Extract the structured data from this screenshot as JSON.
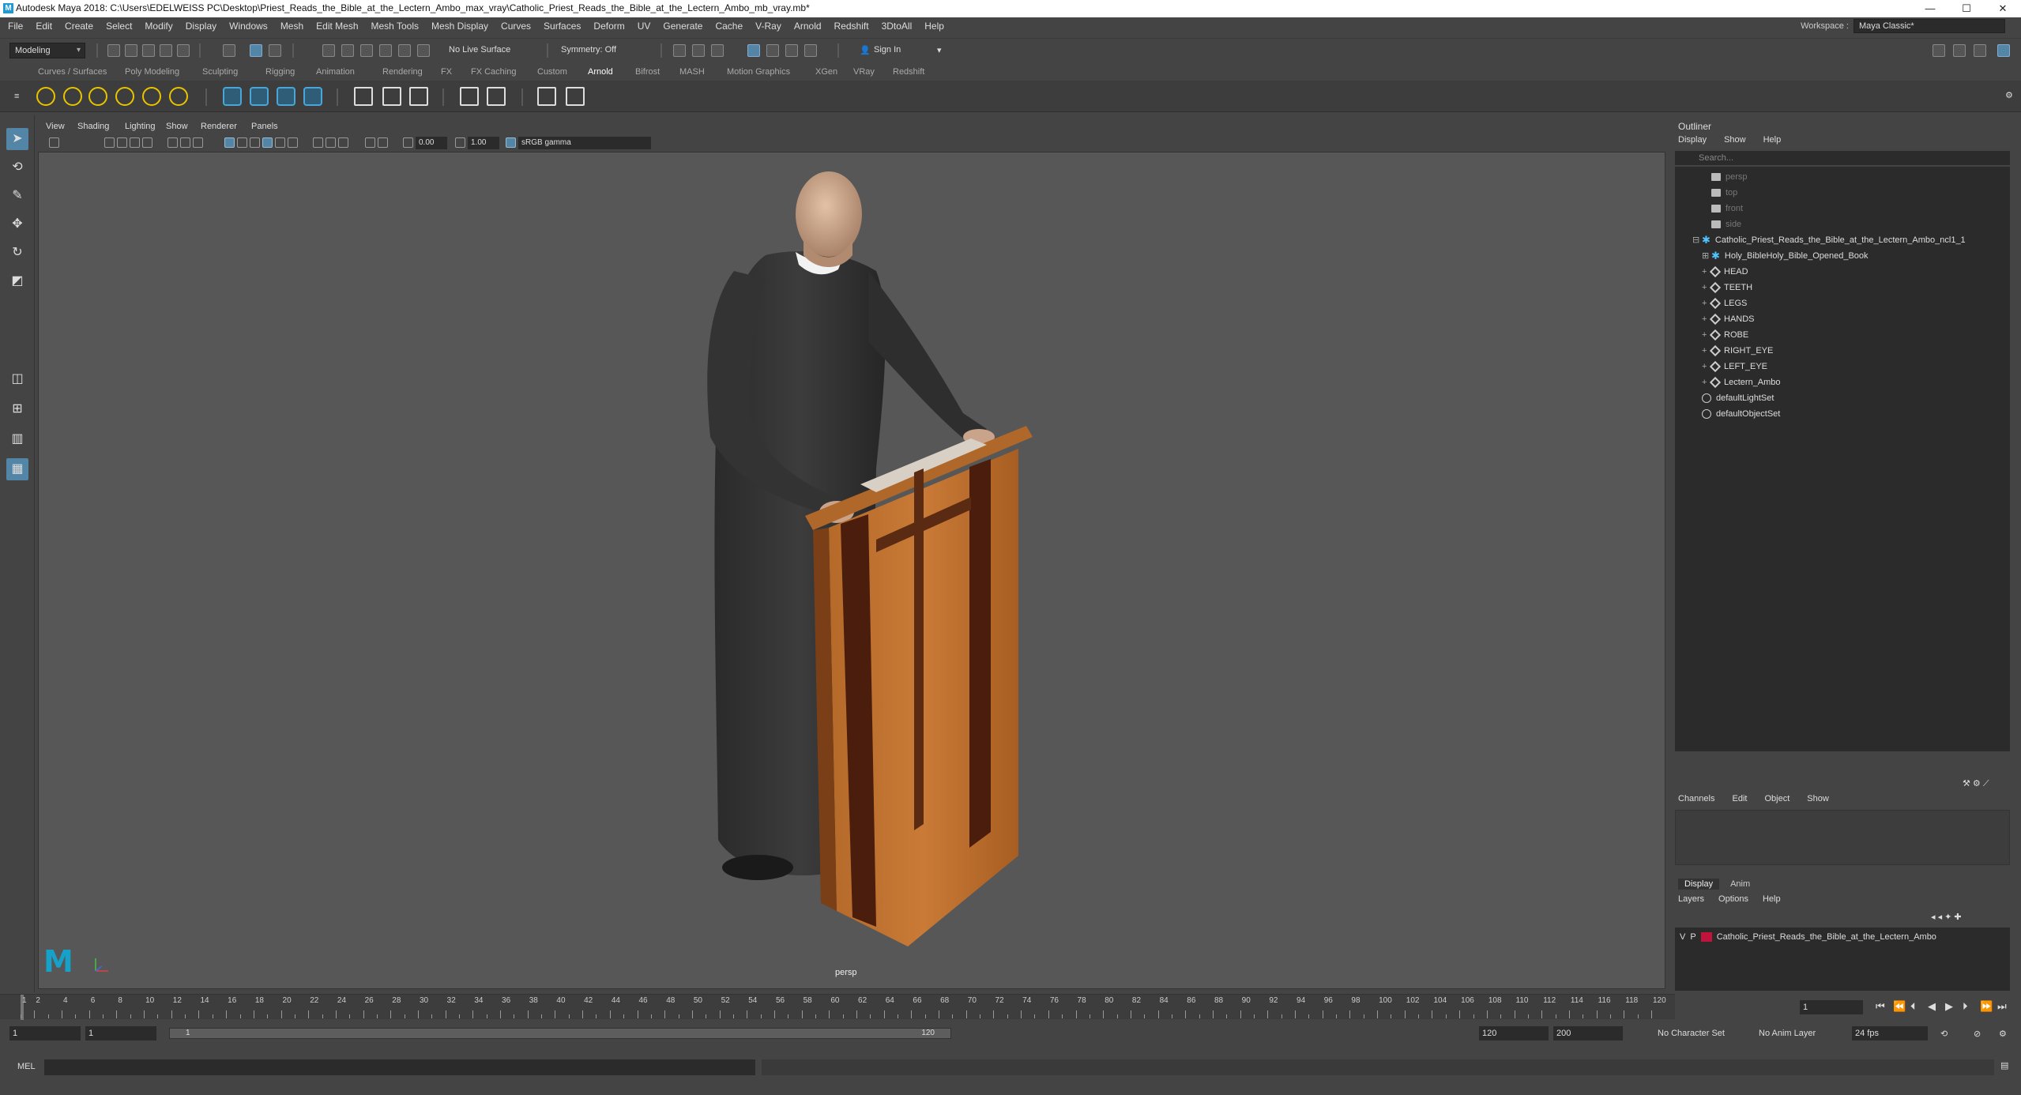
{
  "window": {
    "title": "Autodesk Maya 2018: C:\\Users\\EDELWEISS PC\\Desktop\\Priest_Reads_the_Bible_at_the_Lectern_Ambo_max_vray\\Catholic_Priest_Reads_the_Bible_at_the_Lectern_Ambo_mb_vray.mb*",
    "minimize": "—",
    "maximize": "☐",
    "close": "✕"
  },
  "menubar": {
    "items": [
      "File",
      "Edit",
      "Create",
      "Select",
      "Modify",
      "Display",
      "Windows",
      "Mesh",
      "Edit Mesh",
      "Mesh Tools",
      "Mesh Display",
      "Curves",
      "Surfaces",
      "Deform",
      "UV",
      "Generate",
      "Cache",
      "V-Ray",
      "Arnold",
      "Redshift",
      "3DtoAll",
      "Help"
    ],
    "workspace_label": "Workspace :",
    "workspace_value": "Maya Classic*"
  },
  "statusline": {
    "mode": "Modeling",
    "live_surface": "No Live Surface",
    "symmetry": "Symmetry: Off",
    "sign_in": "Sign In"
  },
  "shelf": {
    "tabs": [
      "Curves / Surfaces",
      "Poly Modeling",
      "Sculpting",
      "Rigging",
      "Animation",
      "Rendering",
      "FX",
      "FX Caching",
      "Custom",
      "Arnold",
      "Bifrost",
      "MASH",
      "Motion Graphics",
      "XGen",
      "VRay",
      "Redshift"
    ],
    "active_tab": "Arnold"
  },
  "viewport": {
    "menus": [
      "View",
      "Shading",
      "Lighting",
      "Show",
      "Renderer",
      "Panels"
    ],
    "exposure": "0.00",
    "gamma": "1.00",
    "color_space": "sRGB gamma",
    "camera": "persp"
  },
  "outliner": {
    "title": "Outliner",
    "menus": [
      "Display",
      "Show",
      "Help"
    ],
    "search_placeholder": "Search...",
    "items": [
      {
        "label": "persp",
        "icon": "camera-icon",
        "indent": 1,
        "dim": true
      },
      {
        "label": "top",
        "icon": "camera-icon",
        "indent": 1,
        "dim": true
      },
      {
        "label": "front",
        "icon": "camera-icon",
        "indent": 1,
        "dim": true
      },
      {
        "label": "side",
        "icon": "camera-icon",
        "indent": 1,
        "dim": true
      },
      {
        "label": "Catholic_Priest_Reads_the_Bible_at_the_Lectern_Ambo_ncl1_1",
        "icon": "group-icon",
        "indent": 0,
        "expander": "⊟"
      },
      {
        "label": "Holy_BibleHoly_Bible_Opened_Book",
        "icon": "group-icon",
        "indent": 1,
        "expander": "⊞"
      },
      {
        "label": "HEAD",
        "icon": "transform-icon",
        "indent": 1,
        "expander": "+"
      },
      {
        "label": "TEETH",
        "icon": "transform-icon",
        "indent": 1,
        "expander": "+"
      },
      {
        "label": "LEGS",
        "icon": "transform-icon",
        "indent": 1,
        "expander": "+"
      },
      {
        "label": "HANDS",
        "icon": "transform-icon",
        "indent": 1,
        "expander": "+"
      },
      {
        "label": "ROBE",
        "icon": "transform-icon",
        "indent": 1,
        "expander": "+"
      },
      {
        "label": "RIGHT_EYE",
        "icon": "transform-icon",
        "indent": 1,
        "expander": "+"
      },
      {
        "label": "LEFT_EYE",
        "icon": "transform-icon",
        "indent": 1,
        "expander": "+"
      },
      {
        "label": "Lectern_Ambo",
        "icon": "transform-icon",
        "indent": 1,
        "expander": "+"
      },
      {
        "label": "defaultLightSet",
        "icon": "set-icon",
        "indent": 0
      },
      {
        "label": "defaultObjectSet",
        "icon": "set-icon",
        "indent": 0
      }
    ]
  },
  "channelbox": {
    "menus": [
      "Channels",
      "Edit",
      "Object",
      "Show"
    ]
  },
  "layereditor": {
    "tabs": [
      "Display",
      "Anim"
    ],
    "menus": [
      "Layers",
      "Options",
      "Help"
    ],
    "layer": {
      "v": "V",
      "p": "P",
      "name": "Catholic_Priest_Reads_the_Bible_at_the_Lectern_Ambo",
      "color": "#c0143c"
    }
  },
  "timeslider": {
    "ticks": [
      1,
      2,
      4,
      6,
      8,
      10,
      12,
      14,
      16,
      18,
      20,
      22,
      24,
      26,
      28,
      30,
      32,
      34,
      36,
      38,
      40,
      42,
      44,
      46,
      48,
      50,
      52,
      54,
      56,
      58,
      60,
      62,
      64,
      66,
      68,
      70,
      72,
      74,
      76,
      78,
      80,
      82,
      84,
      86,
      88,
      90,
      92,
      94,
      96,
      98,
      100,
      102,
      104,
      106,
      108,
      110,
      112,
      114,
      116,
      118,
      120
    ],
    "current_frame": "1"
  },
  "rangeslider": {
    "start": "1",
    "anim_start": "1",
    "range_start": "1",
    "range_end": "120",
    "end": "120",
    "anim_end": "200",
    "character_set": "No Character Set",
    "anim_layer": "No Anim Layer",
    "fps": "24 fps"
  },
  "cmdline": {
    "label": "MEL"
  }
}
